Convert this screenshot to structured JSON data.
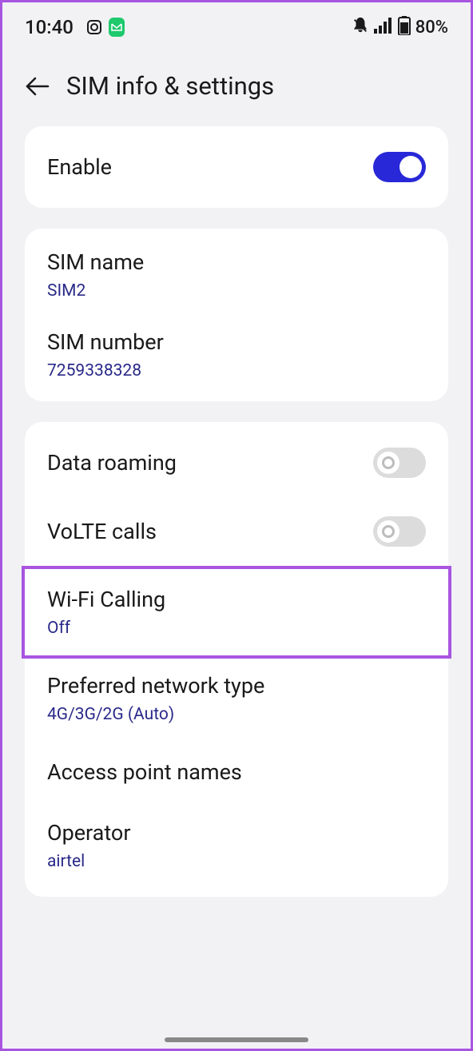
{
  "statusBar": {
    "time": "10:40",
    "batteryPercent": "80%"
  },
  "header": {
    "title": "SIM info & settings"
  },
  "enableSection": {
    "label": "Enable",
    "enabled": true
  },
  "simInfo": {
    "nameLabel": "SIM name",
    "nameValue": "SIM2",
    "numberLabel": "SIM number",
    "numberValue": "7259338328"
  },
  "networkSettings": {
    "dataRoaming": {
      "label": "Data roaming",
      "enabled": false
    },
    "volte": {
      "label": "VoLTE calls",
      "enabled": false
    },
    "wifiCalling": {
      "label": "Wi-Fi Calling",
      "value": "Off"
    },
    "preferredNetwork": {
      "label": "Preferred network type",
      "value": "4G/3G/2G (Auto)"
    },
    "apn": {
      "label": "Access point names"
    },
    "operator": {
      "label": "Operator",
      "value": "airtel"
    }
  }
}
